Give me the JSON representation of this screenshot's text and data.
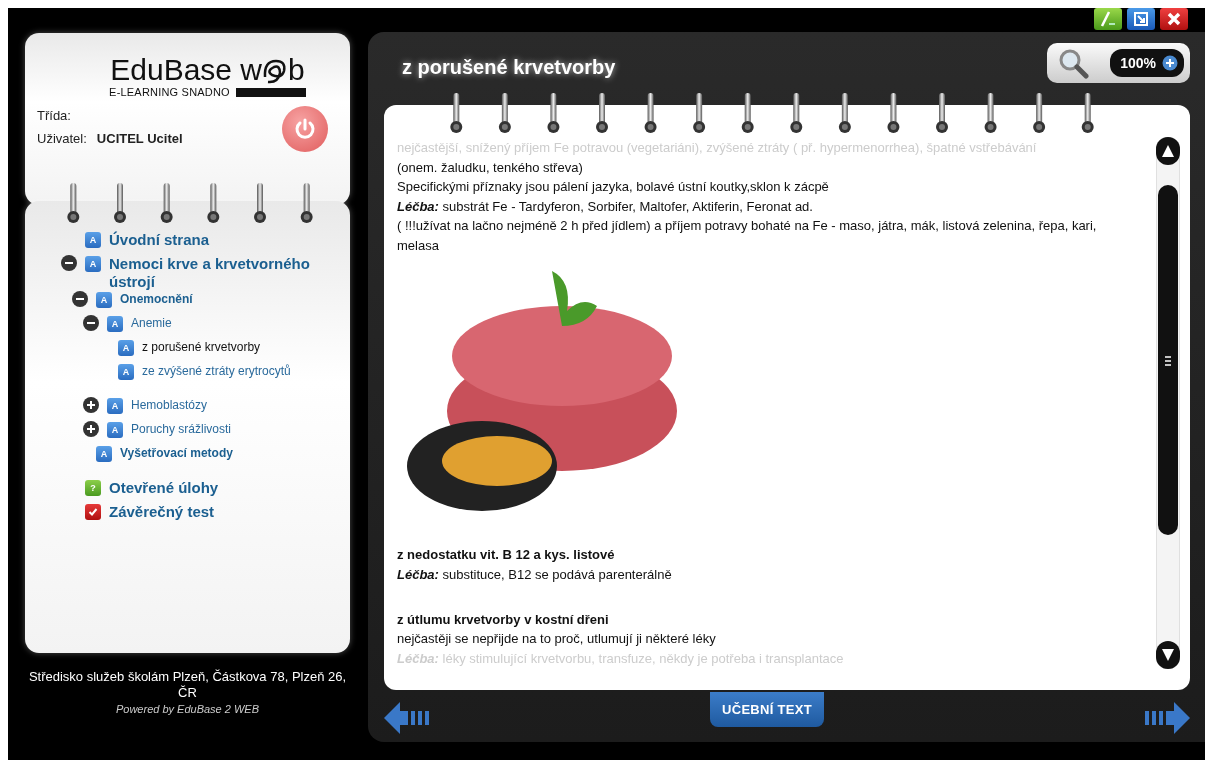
{
  "header": {
    "logo": {
      "text_start": "EduBase w",
      "text_end": "b",
      "tagline": "E-LEARNING SNADNO"
    },
    "class_label": "Třída:",
    "user_label": "Uživatel:",
    "user_value": "UCITEL Ucitel"
  },
  "nav": {
    "items": [
      {
        "label": "Úvodní strana",
        "kind": "page",
        "badge": "A",
        "selected": false
      },
      {
        "label": "Nemoci krve a krvetvorného ústrojí",
        "kind": "page",
        "badge": "A",
        "selected": false,
        "expanded": true,
        "children": [
          {
            "label": "Onemocnění",
            "kind": "page",
            "badge": "A",
            "selected": false,
            "expanded": true,
            "children": [
              {
                "label": "Anemie",
                "kind": "page",
                "badge": "A",
                "selected": false,
                "expanded": true,
                "children": [
                  {
                    "label": "z porušené krvetvorby",
                    "kind": "page",
                    "badge": "A",
                    "selected": true
                  },
                  {
                    "label": "ze zvýšené ztráty erytrocytů",
                    "kind": "page",
                    "badge": "A",
                    "selected": false
                  }
                ]
              },
              {
                "label": "Hemoblastózy",
                "kind": "page",
                "badge": "A",
                "selected": false,
                "expanded": false
              },
              {
                "label": "Poruchy srážlivosti",
                "kind": "page",
                "badge": "A",
                "selected": false,
                "expanded": false
              }
            ]
          },
          {
            "label": "Vyšetřovací metody",
            "kind": "page",
            "badge": "A",
            "selected": false
          }
        ]
      },
      {
        "label": "Otevřené úlohy",
        "kind": "task",
        "badge": "?",
        "selected": false
      },
      {
        "label": "Závěrečný test",
        "kind": "test",
        "selected": false
      }
    ]
  },
  "footer": {
    "address": "Středisko služeb školám Plzeň, Částkova 78, Plzeň 26, ČR",
    "powered": "Powered by EduBase 2 WEB"
  },
  "page": {
    "title": "z porušené krvetvorby",
    "zoom": "100%",
    "content": [
      {
        "kind": "faded",
        "text": "nejčastější, snížený příjem Fe potravou (vegetariáni), zvýšené ztráty ( př. hypermenorrhea), špatné vstřebávání"
      },
      {
        "kind": "text",
        "text": "(onem. žaludku, tenkého střeva)"
      },
      {
        "kind": "text",
        "text": "Specifickými příznaky jsou pálení jazyka, bolavé ústní koutky,sklon k zácpě"
      },
      {
        "kind": "text",
        "text": "**Léčba:** substrát Fe - Tardyferon, Sorbifer, Maltofer, Aktiferin, Feronat ad."
      },
      {
        "kind": "text",
        "text": "( !!!užívat na lačno nejméně 2 h před jídlem) a příjem potravy bohaté na Fe - maso, játra, mák, listová zelenina, řepa, kari, melasa"
      },
      {
        "kind": "image"
      },
      {
        "kind": "heading",
        "text": "z nedostatku vit. B 12 a kys. listové"
      },
      {
        "kind": "text",
        "text": "**Léčba:** substituce, B12 se podává parenterálně"
      },
      {
        "kind": "blank"
      },
      {
        "kind": "heading",
        "text": "z útlumu krvetvorby v kostní dřeni"
      },
      {
        "kind": "text",
        "text": "nejčastěji se nepřijde na to proč, utlumují ji některé léky"
      },
      {
        "kind": "faded",
        "text": "**Léčba:** léky stimulující krvetvorbu, transfuze, někdy je potřeba i transplantace"
      }
    ],
    "tab": "UČEBNÍ TEXT"
  }
}
